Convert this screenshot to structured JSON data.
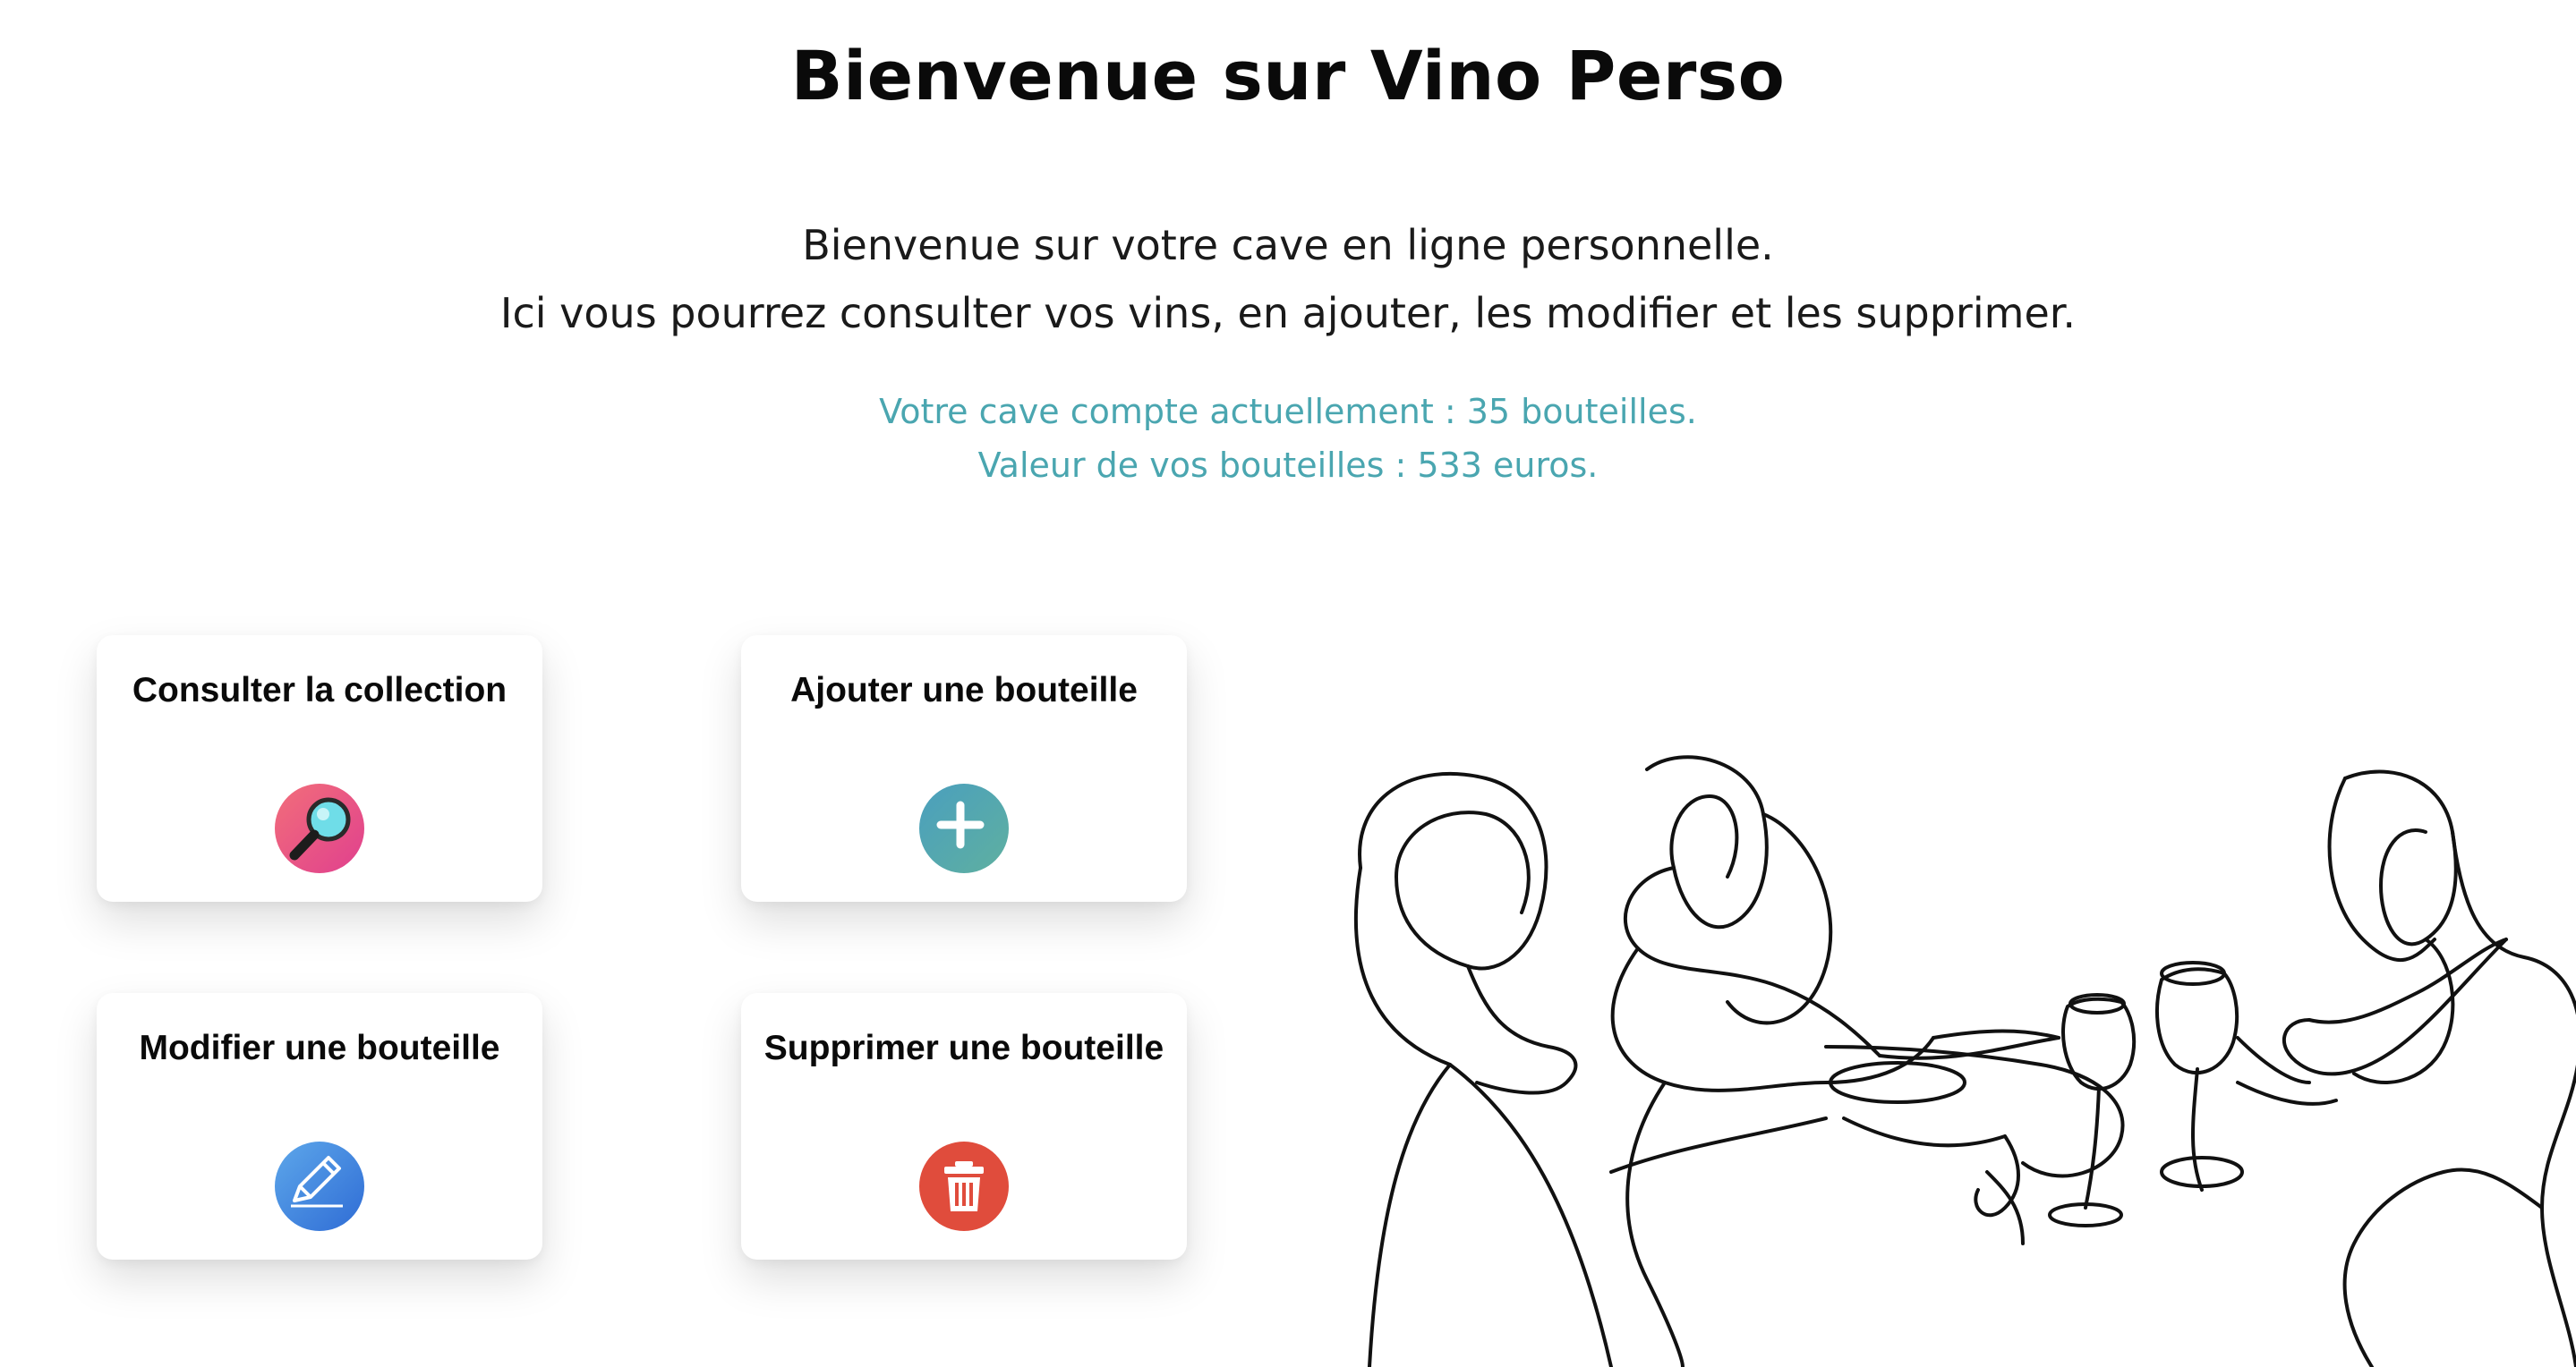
{
  "header": {
    "title": "Bienvenue sur Vino Perso"
  },
  "intro": {
    "line1": "Bienvenue sur votre cave en ligne personnelle.",
    "line2": "Ici vous pourrez consulter vos vins, en ajouter, les modifier et les supprimer."
  },
  "stats": {
    "bottles_line": "Votre cave compte actuellement : 35 bouteilles.",
    "value_line": "Valeur de vos bouteilles : 533 euros."
  },
  "actions": [
    {
      "label": "Consulter la collection",
      "icon": "magnifier-icon",
      "color": "#e8508a"
    },
    {
      "label": "Ajouter une bouteille",
      "icon": "plus-icon",
      "color": "#52a6b0"
    },
    {
      "label": "Modifier une bouteille",
      "icon": "pencil-icon",
      "color": "#3b82e0"
    },
    {
      "label": "Supprimer une bouteille",
      "icon": "trash-icon",
      "color": "#e04c3c"
    }
  ],
  "colors": {
    "accent": "#4aa6b0",
    "text": "#111111",
    "background": "#ffffff"
  },
  "illustration": {
    "icon": "people-toasting-line-art"
  }
}
